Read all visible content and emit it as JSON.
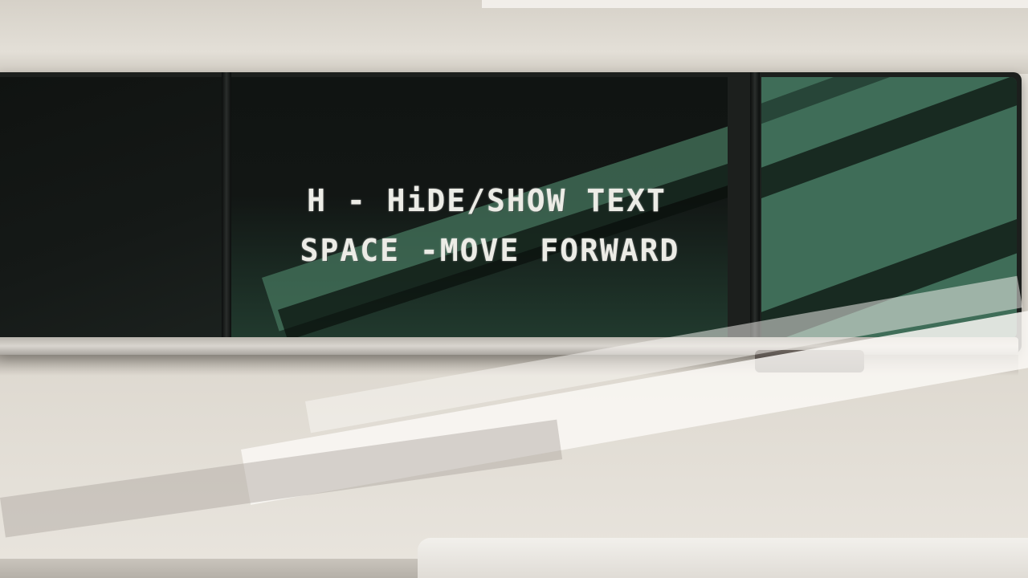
{
  "controls": {
    "hide_show_text": "H - HiDE/SHOW TEXT",
    "move_forward": "SPACE -MOVE FORWARD"
  },
  "colors": {
    "board_dark": "#121614",
    "board_green": "#3f6d58",
    "chalk_text": "#ecece6",
    "wall": "#e6e2da"
  }
}
